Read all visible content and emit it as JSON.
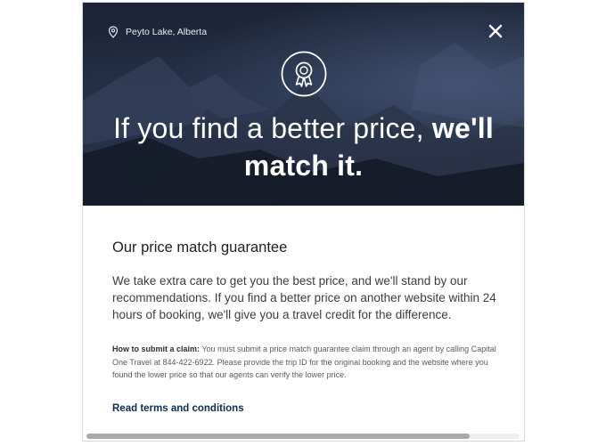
{
  "modal": {
    "location": {
      "icon": "map-pin-icon",
      "text": "Peyto Lake, Alberta"
    },
    "close": {
      "icon": "close-icon",
      "label": "×"
    },
    "badge": {
      "icon": "award-ribbon-icon"
    },
    "headline": {
      "regular": "If you find a better price, ",
      "bold_1": "we'll",
      "bold_2": "match it."
    },
    "section_title": "Our price match guarantee",
    "body": "We take extra care to get you the best price, and we'll stand by our recommendations. If you find a better price on another website within 24 hours of booking, we'll give you a travel credit for the difference.",
    "claim": {
      "label": "How to submit a claim:",
      "text": " You must submit a price match guarantee claim through an agent by calling Capital One Travel at 844-422-6922. Please provide the trip ID for the original booking and the website where you found the lower price so that our agents can verify the lower price."
    },
    "terms_link": "Read terms and conditions"
  },
  "colors": {
    "hero_dark": "#1c2436",
    "link": "#0f2d52",
    "title_text": "#1f1f1f",
    "body_text": "#3d3d3d"
  }
}
